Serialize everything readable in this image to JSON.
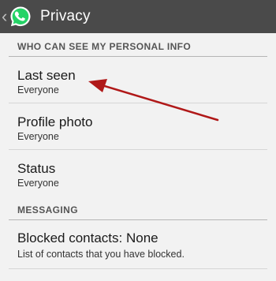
{
  "action_bar": {
    "title": "Privacy",
    "back_glyph": "‹",
    "logo_icon": "whatsapp-logo-icon",
    "background": "#4a4a4a",
    "logo_color": "#25d366"
  },
  "sections": [
    {
      "header": "WHO CAN SEE MY PERSONAL INFO",
      "items": [
        {
          "title": "Last seen",
          "subtitle": "Everyone"
        },
        {
          "title": "Profile photo",
          "subtitle": "Everyone"
        },
        {
          "title": "Status",
          "subtitle": "Everyone"
        }
      ]
    },
    {
      "header": "MESSAGING",
      "items": [
        {
          "title": "Blocked contacts: None",
          "subtitle": "List of contacts that you have blocked."
        }
      ]
    }
  ],
  "annotation": {
    "color": "#b01818",
    "points_to": "Last seen"
  }
}
